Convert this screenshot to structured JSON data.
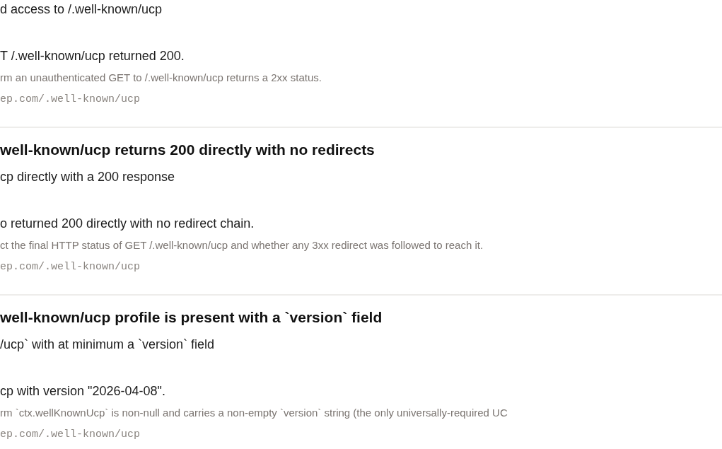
{
  "checks": [
    {
      "subtitle": "d access to /.well-known/ucp",
      "result": "T /.well-known/ucp returned 200.",
      "description": "rm an unauthenticated GET to /.well-known/ucp returns a 2xx status.",
      "url": "ep.com/.well-known/ucp"
    },
    {
      "title": "well-known/ucp returns 200 directly with no redirects",
      "subtitle": "cp directly with a 200 response",
      "result": "o returned 200 directly with no redirect chain.",
      "description": "ct the final HTTP status of GET /.well-known/ucp and whether any 3xx redirect was followed to reach it.",
      "url": "ep.com/.well-known/ucp"
    },
    {
      "title": "well-known/ucp profile is present with a `version` field",
      "subtitle": "/ucp` with at minimum a `version` field",
      "result": "cp with version \"2026-04-08\".",
      "description": "rm `ctx.wellKnownUcp` is non-null and carries a non-empty `version` string (the only universally-required UC",
      "url": "ep.com/.well-known/ucp"
    }
  ]
}
